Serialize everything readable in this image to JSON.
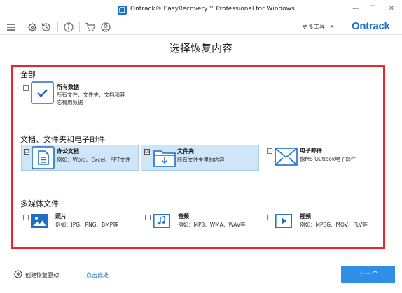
{
  "window": {
    "title": "Ontrack® EasyRecovery™ Professional for Windows",
    "controls": {
      "minimize": "—",
      "maximize": "☐",
      "close": "✕"
    }
  },
  "toolbar": {
    "icons": [
      "menu-icon",
      "settings-icon",
      "history-icon",
      "info-icon",
      "cart-icon",
      "user-icon"
    ],
    "more_tools_label": "更多工具",
    "more_tools_caret": "▾",
    "brand": "Ontrack",
    "accent_color": "#1e6fc4"
  },
  "main": {
    "title": "选择恢复内容",
    "frame_color": "#e8252a",
    "sections": {
      "all": {
        "title": "全部",
        "items": [
          {
            "title": "所有数据",
            "desc_line1": "所有文件、文件夹、文档和其",
            "desc_line2": "它有用数据",
            "checked": false,
            "check_mark": ""
          }
        ]
      },
      "docs": {
        "title": "文档、文件夹和电子邮件",
        "items": [
          {
            "title": "办公文档",
            "desc": "例如：Word、Excel、PPT文件",
            "checked": true,
            "check_mark": "☑"
          },
          {
            "title": "文件夹",
            "desc": "所有文件夹里的内容",
            "checked": true,
            "check_mark": "☑"
          },
          {
            "title": "电子邮件",
            "desc": "像MS Outlook电子邮件",
            "checked": false,
            "check_mark": ""
          }
        ]
      },
      "media": {
        "title": "多媒体文件",
        "items": [
          {
            "title": "照片",
            "desc": "例如：JPG、PNG、BMP等",
            "checked": false,
            "check_mark": ""
          },
          {
            "title": "音频",
            "desc": "例如：MP3、WMA、WAV等",
            "checked": false,
            "check_mark": ""
          },
          {
            "title": "视频",
            "desc": "例如：MPEG、MOV、FLV等",
            "checked": false,
            "check_mark": ""
          }
        ]
      }
    },
    "icon_color": "#1e6fc4",
    "selected_bg": "#cfe5f8"
  },
  "footer": {
    "create_disk_label": "创建恢复驱动",
    "link_label": "点击此处",
    "next_label": "下一个",
    "next_color": "#2f8fe6"
  }
}
